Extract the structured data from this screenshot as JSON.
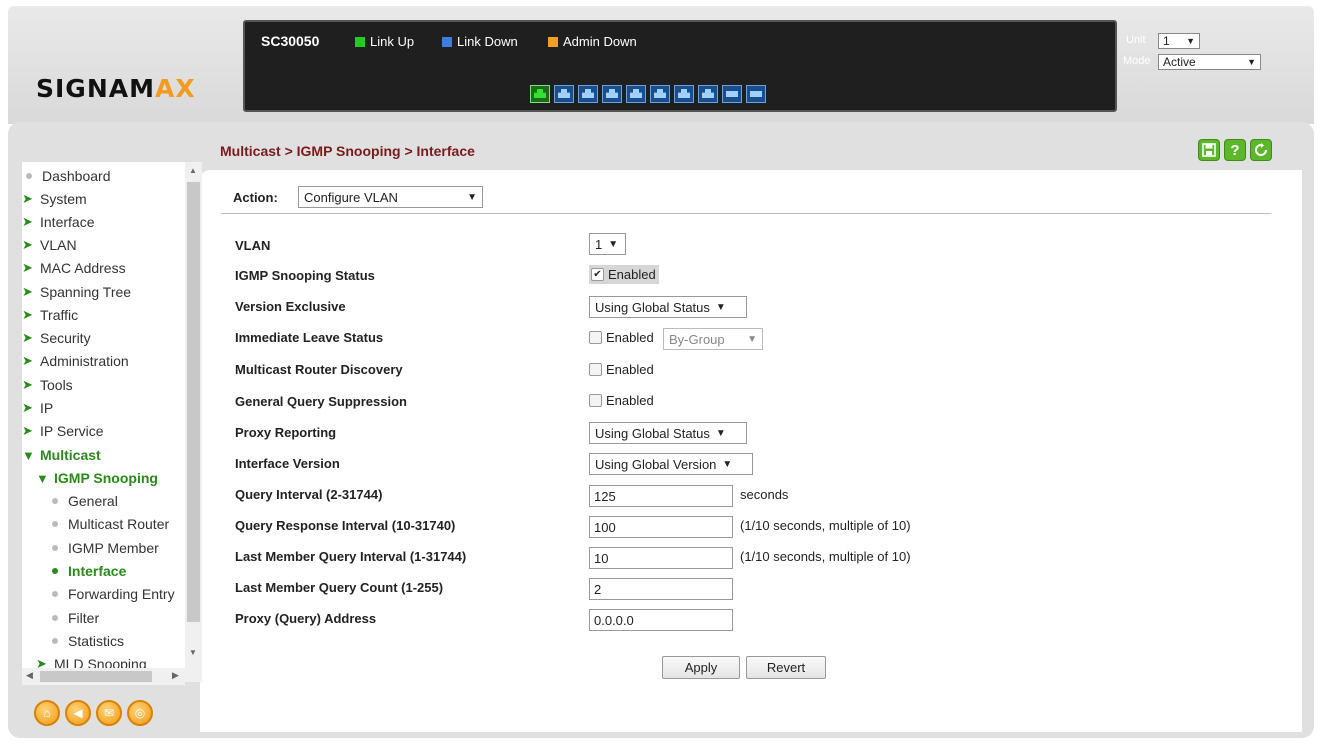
{
  "brand": {
    "logo_main": "SIGNAM",
    "logo_accent": "AX"
  },
  "switch": {
    "model": "SC30050",
    "legend": [
      {
        "label": "Link Up",
        "color": "#22cc22"
      },
      {
        "label": "Link Down",
        "color": "#3b7fe0"
      },
      {
        "label": "Admin Down",
        "color": "#f0a020"
      }
    ],
    "unit_label": "Unit",
    "unit_value": "1",
    "mode_label": "Mode",
    "mode_value": "Active"
  },
  "sidebar": {
    "items": [
      {
        "label": "Dashboard"
      },
      {
        "label": "System"
      },
      {
        "label": "Interface"
      },
      {
        "label": "VLAN"
      },
      {
        "label": "MAC Address"
      },
      {
        "label": "Spanning Tree"
      },
      {
        "label": "Traffic"
      },
      {
        "label": "Security"
      },
      {
        "label": "Administration"
      },
      {
        "label": "Tools"
      },
      {
        "label": "IP"
      },
      {
        "label": "IP Service"
      },
      {
        "label": "Multicast"
      },
      {
        "label": "IGMP Snooping"
      },
      {
        "label": "General"
      },
      {
        "label": "Multicast Router"
      },
      {
        "label": "IGMP Member"
      },
      {
        "label": "Interface"
      },
      {
        "label": "Forwarding Entry"
      },
      {
        "label": "Filter"
      },
      {
        "label": "Statistics"
      },
      {
        "label": "MLD Snooping"
      }
    ]
  },
  "header": {
    "breadcrumb": "Multicast > IGMP Snooping > Interface"
  },
  "action": {
    "label": "Action:",
    "value": "Configure VLAN"
  },
  "form": {
    "vlan": {
      "label": "VLAN",
      "value": "1"
    },
    "igmp_status": {
      "label": "IGMP Snooping Status",
      "checkbox": "Enabled",
      "checked": true
    },
    "version_exclusive": {
      "label": "Version Exclusive",
      "value": "Using Global Status"
    },
    "immediate_leave": {
      "label": "Immediate Leave Status",
      "checkbox": "Enabled",
      "checked": false,
      "select": "By-Group"
    },
    "mrouter_discovery": {
      "label": "Multicast Router Discovery",
      "checkbox": "Enabled",
      "checked": false
    },
    "gq_suppression": {
      "label": "General Query Suppression",
      "checkbox": "Enabled",
      "checked": false
    },
    "proxy_reporting": {
      "label": "Proxy Reporting",
      "value": "Using Global Status"
    },
    "interface_version": {
      "label": "Interface Version",
      "value": "Using Global Version"
    },
    "query_interval": {
      "label": "Query Interval (2-31744)",
      "value": "125",
      "unit": "seconds"
    },
    "query_response": {
      "label": "Query Response Interval (10-31740)",
      "value": "100",
      "unit": "(1/10 seconds, multiple of 10)"
    },
    "last_member_interval": {
      "label": "Last Member Query Interval (1-31744)",
      "value": "10",
      "unit": "(1/10 seconds, multiple of 10)"
    },
    "last_member_count": {
      "label": "Last Member Query Count (1-255)",
      "value": "2"
    },
    "proxy_address": {
      "label": "Proxy (Query) Address",
      "value": "0.0.0.0"
    }
  },
  "buttons": {
    "apply": "Apply",
    "revert": "Revert"
  }
}
